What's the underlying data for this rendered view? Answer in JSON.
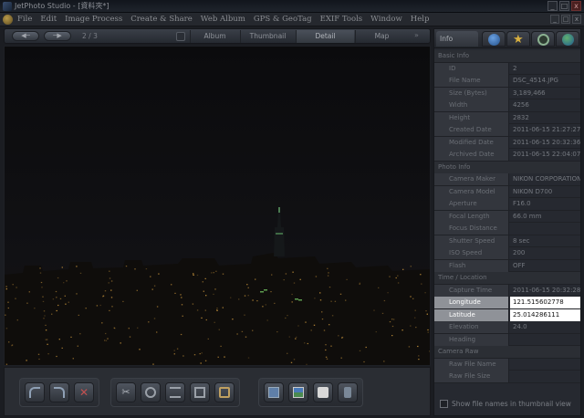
{
  "window": {
    "title": "JetPhoto Studio - [資料夾*]",
    "buttons": [
      "_",
      "□",
      "x"
    ]
  },
  "menu": {
    "items": [
      "File",
      "Edit",
      "Image Process",
      "Create & Share",
      "Web Album",
      "GPS & GeoTag",
      "EXIF Tools",
      "Window",
      "Help"
    ],
    "mdi_buttons": [
      "_",
      "□",
      "x"
    ]
  },
  "nav": {
    "prev": "◀─",
    "next": "─▶",
    "counter": "2 / 3",
    "tabs": [
      "Album",
      "Thumbnail",
      "Detail",
      "Map"
    ],
    "active_tab": "Detail",
    "more": "»"
  },
  "info_panel": {
    "tab_label": "Info",
    "icon_tabs": [
      "info-icon",
      "star-icon",
      "clock-icon",
      "globe-icon"
    ],
    "rows": [
      {
        "section": "Basic Info"
      },
      {
        "key": "ID",
        "value": "2"
      },
      {
        "key": "File Name",
        "value": "DSC_4514.JPG"
      },
      {
        "key": "Size (Bytes)",
        "value": "3,189,466"
      },
      {
        "key": "Width",
        "value": "4256"
      },
      {
        "key": "Height",
        "value": "2832"
      },
      {
        "key": "Created Date",
        "value": "2011-06-15 21:27:27"
      },
      {
        "key": "Modified Date",
        "value": "2011-06-15 20:32:36"
      },
      {
        "key": "Archived Date",
        "value": "2011-06-15 22:04:07"
      },
      {
        "section": "Photo Info"
      },
      {
        "key": "Camera Maker",
        "value": "NIKON CORPORATION"
      },
      {
        "key": "Camera Model",
        "value": "NIKON D700"
      },
      {
        "key": "Aperture",
        "value": "F16.0"
      },
      {
        "key": "Focal Length",
        "value": "66.0 mm"
      },
      {
        "key": "Focus Distance",
        "value": ""
      },
      {
        "key": "Shutter Speed",
        "value": "8 sec"
      },
      {
        "key": "ISO Speed",
        "value": "200"
      },
      {
        "key": "Flash",
        "value": "OFF"
      },
      {
        "section": "Time / Location"
      },
      {
        "key": "Capture Time",
        "value": "2011-06-15 20:32:28"
      },
      {
        "key": "Longitude",
        "value": "121.515602778",
        "highlight": true
      },
      {
        "key": "Latitude",
        "value": "25.014286111",
        "highlight": true
      },
      {
        "key": "Elevation",
        "value": "24.0"
      },
      {
        "key": "Heading",
        "value": ""
      },
      {
        "section": "Camera Raw"
      },
      {
        "key": "Raw File Name",
        "value": ""
      },
      {
        "key": "Raw File Size",
        "value": ""
      }
    ],
    "thumbnail_option": "Show file names in thumbnail view"
  },
  "toolbar": {
    "groups": [
      [
        "undo-icon",
        "redo-icon",
        "delete-icon"
      ],
      [
        "cut-icon",
        "edit-icon",
        "adjust-icon",
        "crop-icon",
        "rotate-icon"
      ],
      [
        "slideshow-icon",
        "picture-icon",
        "print-icon",
        "device-icon"
      ]
    ]
  },
  "colors": {
    "highlight_key": "#8f9298",
    "highlight_value": "#ffffff",
    "city_light": "#d8a040",
    "tower_light": "#70c060"
  }
}
